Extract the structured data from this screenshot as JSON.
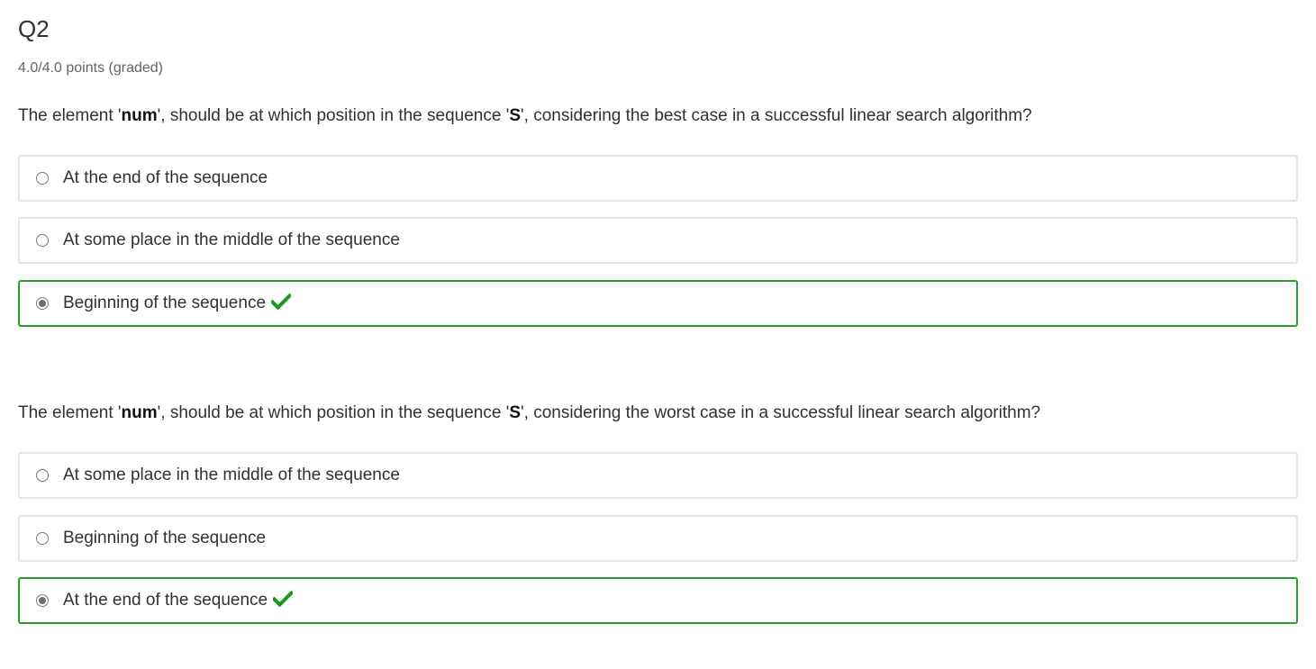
{
  "question": {
    "title": "Q2",
    "points": "4.0/4.0 points (graded)"
  },
  "problems": [
    {
      "prompt_parts": [
        "The element '",
        "num",
        "', should be at which position in the sequence '",
        "S",
        "', considering the best case in a successful linear search algorithm?"
      ],
      "options": [
        {
          "label": "At the end of the sequence",
          "selected": false,
          "correct": false
        },
        {
          "label": "At some place in the middle of the sequence",
          "selected": false,
          "correct": false
        },
        {
          "label": "Beginning of the sequence",
          "selected": true,
          "correct": true
        }
      ]
    },
    {
      "prompt_parts": [
        "The element '",
        "num",
        "', should be at which position in the sequence '",
        "S",
        "', considering the worst case in a successful linear search algorithm?"
      ],
      "options": [
        {
          "label": "At some place in the middle of the sequence",
          "selected": false,
          "correct": false
        },
        {
          "label": "Beginning of the sequence",
          "selected": false,
          "correct": false
        },
        {
          "label": "At the end of the sequence",
          "selected": true,
          "correct": true
        }
      ]
    }
  ],
  "icons": {
    "correct": "checkmark-icon",
    "radio": "radio-button-icon"
  },
  "colors": {
    "correct_border": "#2a9d2a",
    "checkmark": "#1a9a1a",
    "option_border": "#e4e4e4"
  }
}
